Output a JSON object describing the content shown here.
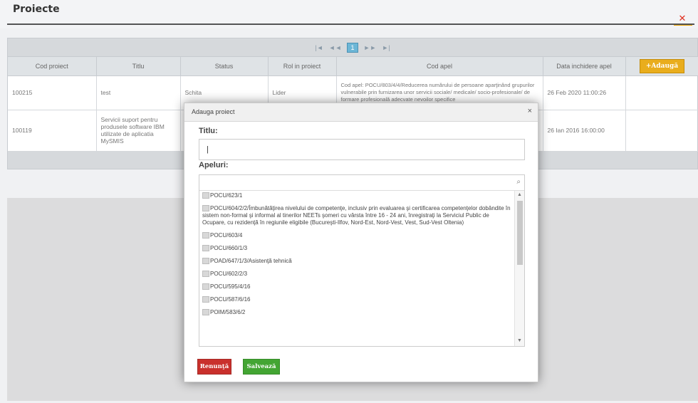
{
  "page": {
    "title": "Proiecte",
    "close_glyph": "✕"
  },
  "pager": {
    "first": "|◄",
    "prev": "◄◄",
    "current": "1",
    "next": "►►",
    "last": "►|"
  },
  "table": {
    "headers": [
      "Cod proiect",
      "Titlu",
      "Status",
      "Rol in proiect",
      "Cod apel",
      "Data inchidere apel"
    ],
    "add_button": "+Adaugă",
    "rows": [
      {
        "cod": "100215",
        "titlu": "test",
        "status": "Schita",
        "rol": "Lider",
        "apel": "Cod apel: POCU/803/4/4/Reducerea numărului de persoane aparţinând grupurilor vulnerabile prin furnizarea unor servicii sociale/ medicale/ socio-profesionale/ de formare profesională adecvate nevoilor specifice",
        "data": "26 Feb 2020 11:00:26"
      },
      {
        "cod": "100119",
        "titlu": "Servicii suport pentru produsele software IBM utilizate de aplicatia MySMIS",
        "status": "",
        "rol": "",
        "apel": "",
        "data": "26 Ian 2016 16:00:00"
      }
    ]
  },
  "modal": {
    "title": "Adauga proiect",
    "close_glyph": "×",
    "titlu_label": "Titlu:",
    "titlu_value": "|",
    "apeluri_label": "Apeluri:",
    "search_glyph": "⌕",
    "items": [
      "POCU/623/1",
      "POCU/604/2/2/Îmbunătăţirea nivelului de competenţe, inclusiv prin evaluarea şi certificarea competenţelor dobândite în sistem non-formal şi informal al tinerilor NEETs şomeri cu vârsta între 16 - 24 ani, înregistraţi la Serviciul Public de Ocupare, cu rezidenţă în regiunile eligibile (Bucureşti-Ilfov, Nord-Est, Nord-Vest, Vest, Sud-Vest Oltenia)",
      "POCU/603/4",
      "POCU/660/1/3",
      "POAD/647/1/3/Asistenţă tehnică",
      "POCU/602/2/3",
      "POCU/595/4/16",
      "POCU/587/6/16",
      "POIM/583/6/2"
    ],
    "cancel_label": "Renunţă",
    "save_label": "Salvează"
  },
  "colors": {
    "add": "#e9ad1d",
    "cancel": "#c9302c",
    "save": "#43a533",
    "close": "#e03020"
  }
}
